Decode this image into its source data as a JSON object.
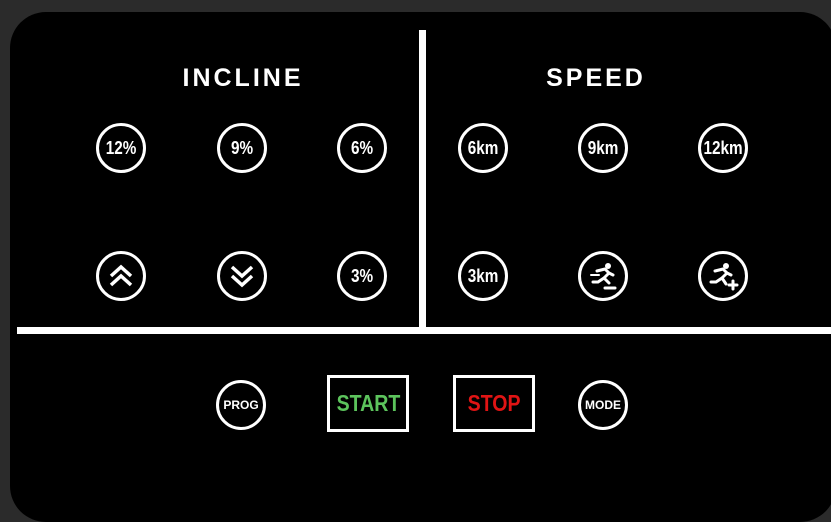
{
  "incline": {
    "title": "INCLINE",
    "buttons": {
      "b12": "12%",
      "b9": "9%",
      "b6": "6%",
      "b3": "3%"
    },
    "up_icon": "double-chevron-up-icon",
    "down_icon": "double-chevron-down-icon"
  },
  "speed": {
    "title": "SPEED",
    "buttons": {
      "b6": "6km",
      "b9": "9km",
      "b12": "12km",
      "b3": "3km"
    },
    "minus_icon": "runner-minus-icon",
    "plus_icon": "runner-plus-icon"
  },
  "controls": {
    "prog": "PROG",
    "start": "START",
    "stop": "STOP",
    "mode": "MODE"
  },
  "colors": {
    "start_text": "#5cc35c",
    "stop_text": "#e01414",
    "panel_bg": "#000000",
    "frame_bg": "#2b2b2b"
  }
}
